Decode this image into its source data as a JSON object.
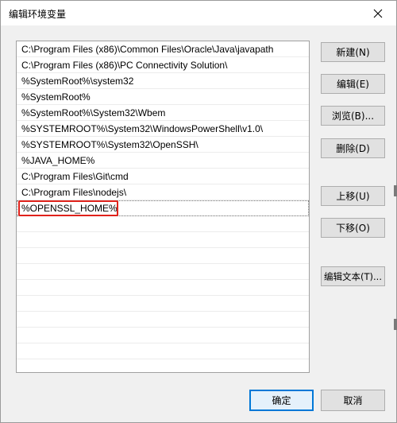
{
  "window": {
    "title": "编辑环境变量",
    "close_icon": "close-icon"
  },
  "paths": [
    "C:\\Program Files (x86)\\Common Files\\Oracle\\Java\\javapath",
    "C:\\Program Files (x86)\\PC Connectivity Solution\\",
    "%SystemRoot%\\system32",
    "%SystemRoot%",
    "%SystemRoot%\\System32\\Wbem",
    "%SYSTEMROOT%\\System32\\WindowsPowerShell\\v1.0\\",
    "%SYSTEMROOT%\\System32\\OpenSSH\\",
    "%JAVA_HOME%",
    "C:\\Program Files\\Git\\cmd",
    "C:\\Program Files\\nodejs\\",
    "%OPENSSL_HOME%"
  ],
  "buttons": {
    "new": "新建(N)",
    "edit": "编辑(E)",
    "browse": "浏览(B)...",
    "delete": "删除(D)",
    "move_up": "上移(U)",
    "move_down": "下移(O)",
    "edit_text": "编辑文本(T)...",
    "ok": "确定",
    "cancel": "取消"
  },
  "colors": {
    "highlight_border": "#e0221b",
    "primary_border": "#0078d7"
  }
}
